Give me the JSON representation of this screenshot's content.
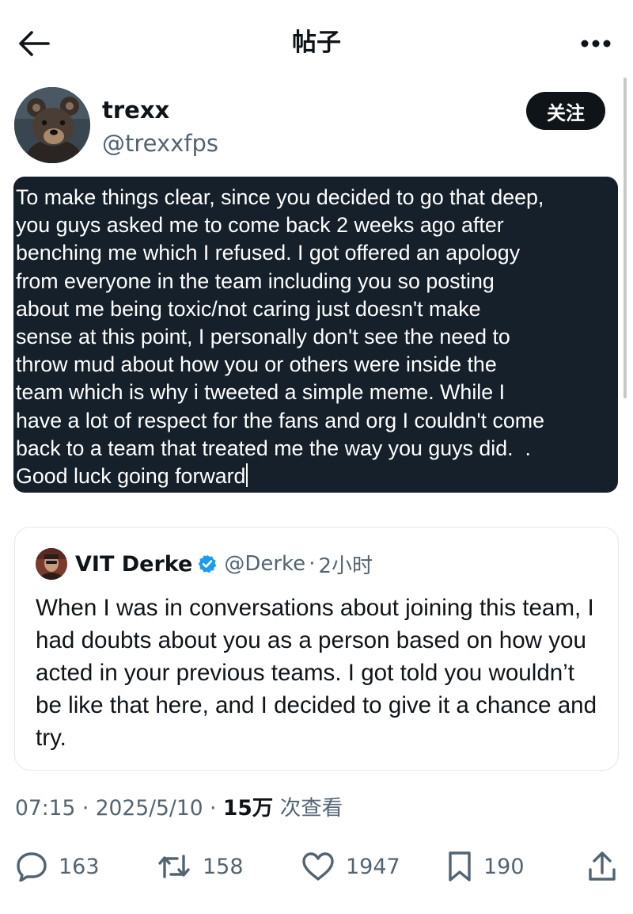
{
  "header": {
    "title": "帖子",
    "back_icon": "arrow-left-icon",
    "more_icon": "more-horizontal-icon"
  },
  "author": {
    "display_name": "trexx",
    "handle": "@trexxfps",
    "follow_label": "关注"
  },
  "tweet": {
    "lines": [
      "To make things clear, since you decided to go that deep,",
      "you guys asked me to come back 2 weeks ago after",
      "benching me which I refused. I got offered an apology",
      "from everyone in the team including you so posting",
      "about me being toxic/not caring just doesn't make",
      "sense at this point, I personally don't see the need to",
      "throw mud about how you or others were inside the",
      "team which is why i tweeted a simple meme. While I",
      "have a lot of respect for the fans and org I couldn't come",
      "back to a team that treated me the way you guys did.  .",
      "Good luck going forward"
    ]
  },
  "quote": {
    "display_name": "VIT Derke",
    "handle": "@Derke",
    "separator": "·",
    "time": "2小时",
    "text": "When I was in conversations about joining this team, I had doubts about you as a person based on how you acted in your previous teams. I got told you wouldn’t be like that here, and I decided to give it a chance and try."
  },
  "meta": {
    "time": "07:15",
    "separator": "·",
    "date": "2025/5/10",
    "views_count": "15万",
    "views_label": "次查看"
  },
  "actions": {
    "replies": "163",
    "reposts": "158",
    "likes": "1947",
    "bookmarks": "190"
  },
  "colors": {
    "text": "#0f1419",
    "secondary": "#536471",
    "selection_bg": "#15202b",
    "verified": "#1d9bf0"
  }
}
